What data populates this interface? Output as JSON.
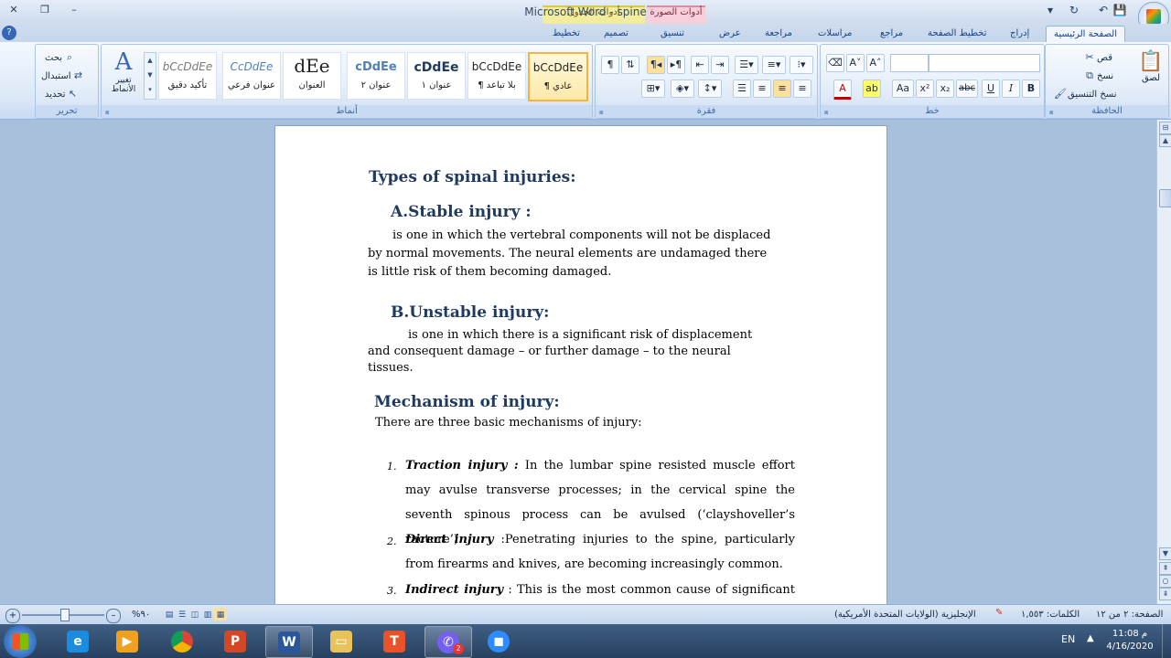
{
  "window": {
    "title": "Microsoft Word - spine",
    "context_tabs": {
      "table_tools": "أدوات الجدول",
      "picture_tools": "أدوات الصورة"
    }
  },
  "tabs": [
    {
      "label": "الصفحة الرئيسية",
      "active": true
    },
    {
      "label": "إدراج"
    },
    {
      "label": "تخطيط الصفحة"
    },
    {
      "label": "مراجع"
    },
    {
      "label": "مراسلات"
    },
    {
      "label": "مراجعة"
    },
    {
      "label": "عرض"
    },
    {
      "label": "تنسيق"
    },
    {
      "label": "تصميم"
    },
    {
      "label": "تخطيط"
    }
  ],
  "ribbon": {
    "clipboard": {
      "label": "الحافظة",
      "paste": "لصق",
      "cut": "قص",
      "copy": "نسخ",
      "format_painter": "نسخ التنسيق"
    },
    "font": {
      "label": "خط"
    },
    "paragraph": {
      "label": "فقرة"
    },
    "styles": {
      "label": "أنماط",
      "items": [
        {
          "preview": "bCcDdEe",
          "name": "¶ عادي",
          "selected": true
        },
        {
          "preview": "bCcDdEe",
          "name": "¶ بلا تباعد"
        },
        {
          "preview": "cDdEe",
          "name": "عنوان ١"
        },
        {
          "preview": "cDdEe",
          "name": "عنوان ٢"
        },
        {
          "preview": "dEe",
          "name": "العنوان"
        },
        {
          "preview": "CcDdEe",
          "name": "عنوان فرعي"
        },
        {
          "preview": "bCcDdEe",
          "name": "تأكيد دقيق"
        }
      ],
      "change_styles": "تغيير الأنماط"
    },
    "editing": {
      "label": "تحرير",
      "find": "بحث",
      "replace": "استبدال",
      "select": "تحديد"
    }
  },
  "document": {
    "heading1": "Types of spinal injuries:",
    "stable_heading": "A.Stable injury  :",
    "stable_text": "is one in which the vertebral components will not be displaced by normal movements. The neural elements are undamaged there is little risk of them becoming damaged.",
    "unstable_heading": "B.Unstable injury:",
    "unstable_text": "is one in which there is a significant risk of displacement and consequent damage – or further damage – to the neural tissues.",
    "mechanism_heading": "Mechanism of injury:",
    "mechanism_intro": "There are three basic mechanisms of injury:",
    "list": [
      {
        "num": "1.",
        "term": "Traction injury :",
        "text": "In the lumbar spine resisted muscle effort may avulse transverse processes; in the cervical spine the seventh spinous process can be avulsed (‘clayshoveller’s racture’)."
      },
      {
        "num": "2.",
        "term": "Direct injury",
        "text": ":Penetrating injuries to the spine, particularly from firearms and knives, are becoming increasingly common."
      },
      {
        "num": "3.",
        "term": "Indirect injury",
        "text": ":  This is the most common cause of significant"
      }
    ]
  },
  "status": {
    "page": "الصفحة: ٢ من ١٢",
    "words": "الكلمات: ١,٥٥٣",
    "language": "الإنجليزية (الولايات المتحدة الأمريكية)",
    "zoom": "%٩٠"
  },
  "taskbar": {
    "lang": "EN",
    "time": "11:08 م",
    "date": "4/16/2020",
    "badge": "2"
  }
}
